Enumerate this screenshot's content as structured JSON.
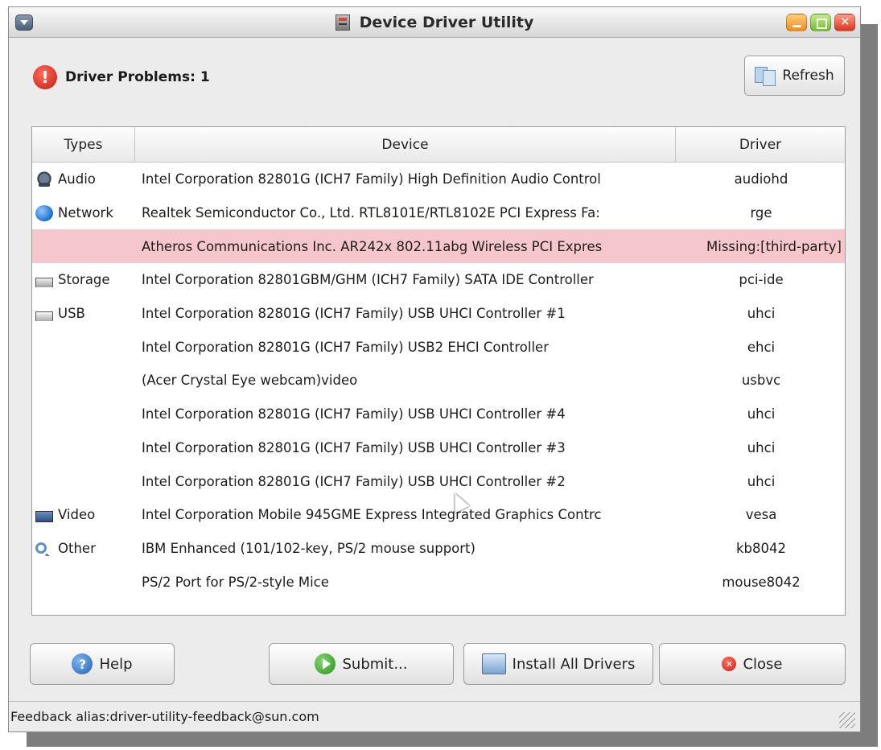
{
  "window": {
    "title": "Device Driver Utility"
  },
  "header": {
    "problems_label": "Driver Problems: 1",
    "refresh_label": "Refresh"
  },
  "table": {
    "columns": [
      "Types",
      "Device",
      "Driver"
    ],
    "rows": [
      {
        "type": "Audio",
        "icon": "audio-icon",
        "device": "Intel Corporation 82801G (ICH7 Family) High Definition Audio Control",
        "driver": "audiohd",
        "problem": false
      },
      {
        "type": "Network",
        "icon": "network-icon",
        "device": "Realtek Semiconductor Co., Ltd. RTL8101E/RTL8102E PCI Express Fa:",
        "driver": "rge",
        "problem": false
      },
      {
        "type": "",
        "icon": "",
        "device": "Atheros Communications Inc. AR242x 802.11abg Wireless PCI Expres",
        "driver": "Missing:[third-party]",
        "problem": true
      },
      {
        "type": "Storage",
        "icon": "storage-icon",
        "device": "Intel Corporation 82801GBM/GHM (ICH7 Family) SATA IDE Controller",
        "driver": "pci-ide",
        "problem": false
      },
      {
        "type": "USB",
        "icon": "usb-icon",
        "device": "Intel Corporation 82801G (ICH7 Family) USB UHCI Controller #1",
        "driver": "uhci",
        "problem": false
      },
      {
        "type": "",
        "icon": "",
        "device": "Intel Corporation 82801G (ICH7 Family) USB2 EHCI Controller",
        "driver": "ehci",
        "problem": false
      },
      {
        "type": "",
        "icon": "",
        "device": "(Acer Crystal Eye webcam)video",
        "driver": "usbvc",
        "problem": false
      },
      {
        "type": "",
        "icon": "",
        "device": "Intel Corporation 82801G (ICH7 Family) USB UHCI Controller #4",
        "driver": "uhci",
        "problem": false
      },
      {
        "type": "",
        "icon": "",
        "device": "Intel Corporation 82801G (ICH7 Family) USB UHCI Controller #3",
        "driver": "uhci",
        "problem": false
      },
      {
        "type": "",
        "icon": "",
        "device": "Intel Corporation 82801G (ICH7 Family) USB UHCI Controller #2",
        "driver": "uhci",
        "problem": false
      },
      {
        "type": "Video",
        "icon": "video-icon",
        "device": "Intel Corporation Mobile 945GME Express Integrated Graphics Contrc",
        "driver": "vesa",
        "problem": false
      },
      {
        "type": "Other",
        "icon": "other-icon",
        "device": "IBM Enhanced (101/102-key, PS/2 mouse support)",
        "driver": "kb8042",
        "problem": false
      },
      {
        "type": "",
        "icon": "",
        "device": "PS/2 Port for PS/2-style Mice",
        "driver": "mouse8042",
        "problem": false
      }
    ]
  },
  "buttons": {
    "help": "Help",
    "submit": "Submit...",
    "install": "Install All Drivers",
    "close": "Close"
  },
  "status": {
    "feedback": "Feedback alias:driver-utility-feedback@sun.com"
  },
  "colors": {
    "problem_row": "#f6c6cd",
    "window_bg": "#ececec"
  }
}
